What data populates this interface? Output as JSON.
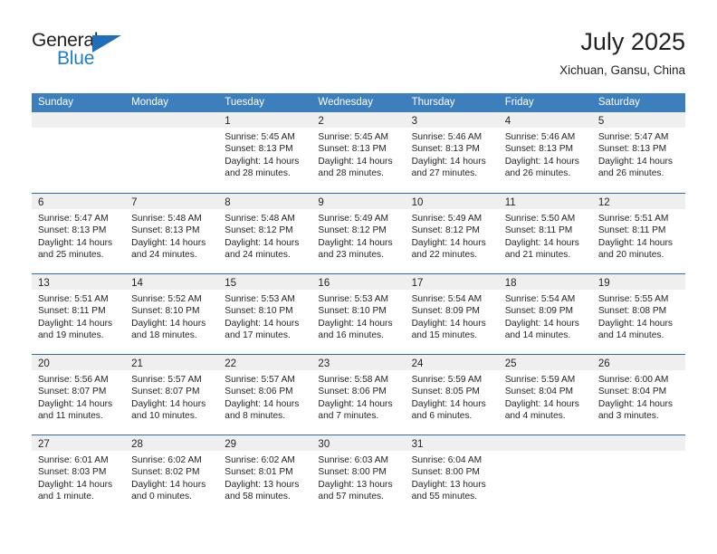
{
  "brand": {
    "word_one": "General",
    "word_two": "Blue"
  },
  "header": {
    "month_title": "July 2025",
    "location": "Xichuan, Gansu, China"
  },
  "colors": {
    "header_blue": "#3d7ebd",
    "separator_blue": "#2f6ca8",
    "daynum_band": "#efefef",
    "brand_blue": "#1f7fc4",
    "text": "#231f20"
  },
  "calendar": {
    "weekday_headers": [
      "Sunday",
      "Monday",
      "Tuesday",
      "Wednesday",
      "Thursday",
      "Friday",
      "Saturday"
    ],
    "weeks": [
      [
        {
          "day": "",
          "lines": []
        },
        {
          "day": "",
          "lines": []
        },
        {
          "day": "1",
          "lines": [
            "Sunrise: 5:45 AM",
            "Sunset: 8:13 PM",
            "Daylight: 14 hours",
            "and 28 minutes."
          ]
        },
        {
          "day": "2",
          "lines": [
            "Sunrise: 5:45 AM",
            "Sunset: 8:13 PM",
            "Daylight: 14 hours",
            "and 28 minutes."
          ]
        },
        {
          "day": "3",
          "lines": [
            "Sunrise: 5:46 AM",
            "Sunset: 8:13 PM",
            "Daylight: 14 hours",
            "and 27 minutes."
          ]
        },
        {
          "day": "4",
          "lines": [
            "Sunrise: 5:46 AM",
            "Sunset: 8:13 PM",
            "Daylight: 14 hours",
            "and 26 minutes."
          ]
        },
        {
          "day": "5",
          "lines": [
            "Sunrise: 5:47 AM",
            "Sunset: 8:13 PM",
            "Daylight: 14 hours",
            "and 26 minutes."
          ]
        }
      ],
      [
        {
          "day": "6",
          "lines": [
            "Sunrise: 5:47 AM",
            "Sunset: 8:13 PM",
            "Daylight: 14 hours",
            "and 25 minutes."
          ]
        },
        {
          "day": "7",
          "lines": [
            "Sunrise: 5:48 AM",
            "Sunset: 8:13 PM",
            "Daylight: 14 hours",
            "and 24 minutes."
          ]
        },
        {
          "day": "8",
          "lines": [
            "Sunrise: 5:48 AM",
            "Sunset: 8:12 PM",
            "Daylight: 14 hours",
            "and 24 minutes."
          ]
        },
        {
          "day": "9",
          "lines": [
            "Sunrise: 5:49 AM",
            "Sunset: 8:12 PM",
            "Daylight: 14 hours",
            "and 23 minutes."
          ]
        },
        {
          "day": "10",
          "lines": [
            "Sunrise: 5:49 AM",
            "Sunset: 8:12 PM",
            "Daylight: 14 hours",
            "and 22 minutes."
          ]
        },
        {
          "day": "11",
          "lines": [
            "Sunrise: 5:50 AM",
            "Sunset: 8:11 PM",
            "Daylight: 14 hours",
            "and 21 minutes."
          ]
        },
        {
          "day": "12",
          "lines": [
            "Sunrise: 5:51 AM",
            "Sunset: 8:11 PM",
            "Daylight: 14 hours",
            "and 20 minutes."
          ]
        }
      ],
      [
        {
          "day": "13",
          "lines": [
            "Sunrise: 5:51 AM",
            "Sunset: 8:11 PM",
            "Daylight: 14 hours",
            "and 19 minutes."
          ]
        },
        {
          "day": "14",
          "lines": [
            "Sunrise: 5:52 AM",
            "Sunset: 8:10 PM",
            "Daylight: 14 hours",
            "and 18 minutes."
          ]
        },
        {
          "day": "15",
          "lines": [
            "Sunrise: 5:53 AM",
            "Sunset: 8:10 PM",
            "Daylight: 14 hours",
            "and 17 minutes."
          ]
        },
        {
          "day": "16",
          "lines": [
            "Sunrise: 5:53 AM",
            "Sunset: 8:10 PM",
            "Daylight: 14 hours",
            "and 16 minutes."
          ]
        },
        {
          "day": "17",
          "lines": [
            "Sunrise: 5:54 AM",
            "Sunset: 8:09 PM",
            "Daylight: 14 hours",
            "and 15 minutes."
          ]
        },
        {
          "day": "18",
          "lines": [
            "Sunrise: 5:54 AM",
            "Sunset: 8:09 PM",
            "Daylight: 14 hours",
            "and 14 minutes."
          ]
        },
        {
          "day": "19",
          "lines": [
            "Sunrise: 5:55 AM",
            "Sunset: 8:08 PM",
            "Daylight: 14 hours",
            "and 14 minutes."
          ]
        }
      ],
      [
        {
          "day": "20",
          "lines": [
            "Sunrise: 5:56 AM",
            "Sunset: 8:07 PM",
            "Daylight: 14 hours",
            "and 11 minutes."
          ]
        },
        {
          "day": "21",
          "lines": [
            "Sunrise: 5:57 AM",
            "Sunset: 8:07 PM",
            "Daylight: 14 hours",
            "and 10 minutes."
          ]
        },
        {
          "day": "22",
          "lines": [
            "Sunrise: 5:57 AM",
            "Sunset: 8:06 PM",
            "Daylight: 14 hours",
            "and 8 minutes."
          ]
        },
        {
          "day": "23",
          "lines": [
            "Sunrise: 5:58 AM",
            "Sunset: 8:06 PM",
            "Daylight: 14 hours",
            "and 7 minutes."
          ]
        },
        {
          "day": "24",
          "lines": [
            "Sunrise: 5:59 AM",
            "Sunset: 8:05 PM",
            "Daylight: 14 hours",
            "and 6 minutes."
          ]
        },
        {
          "day": "25",
          "lines": [
            "Sunrise: 5:59 AM",
            "Sunset: 8:04 PM",
            "Daylight: 14 hours",
            "and 4 minutes."
          ]
        },
        {
          "day": "26",
          "lines": [
            "Sunrise: 6:00 AM",
            "Sunset: 8:04 PM",
            "Daylight: 14 hours",
            "and 3 minutes."
          ]
        }
      ],
      [
        {
          "day": "27",
          "lines": [
            "Sunrise: 6:01 AM",
            "Sunset: 8:03 PM",
            "Daylight: 14 hours",
            "and 1 minute."
          ]
        },
        {
          "day": "28",
          "lines": [
            "Sunrise: 6:02 AM",
            "Sunset: 8:02 PM",
            "Daylight: 14 hours",
            "and 0 minutes."
          ]
        },
        {
          "day": "29",
          "lines": [
            "Sunrise: 6:02 AM",
            "Sunset: 8:01 PM",
            "Daylight: 13 hours",
            "and 58 minutes."
          ]
        },
        {
          "day": "30",
          "lines": [
            "Sunrise: 6:03 AM",
            "Sunset: 8:00 PM",
            "Daylight: 13 hours",
            "and 57 minutes."
          ]
        },
        {
          "day": "31",
          "lines": [
            "Sunrise: 6:04 AM",
            "Sunset: 8:00 PM",
            "Daylight: 13 hours",
            "and 55 minutes."
          ]
        },
        {
          "day": "",
          "lines": []
        },
        {
          "day": "",
          "lines": []
        }
      ]
    ]
  }
}
